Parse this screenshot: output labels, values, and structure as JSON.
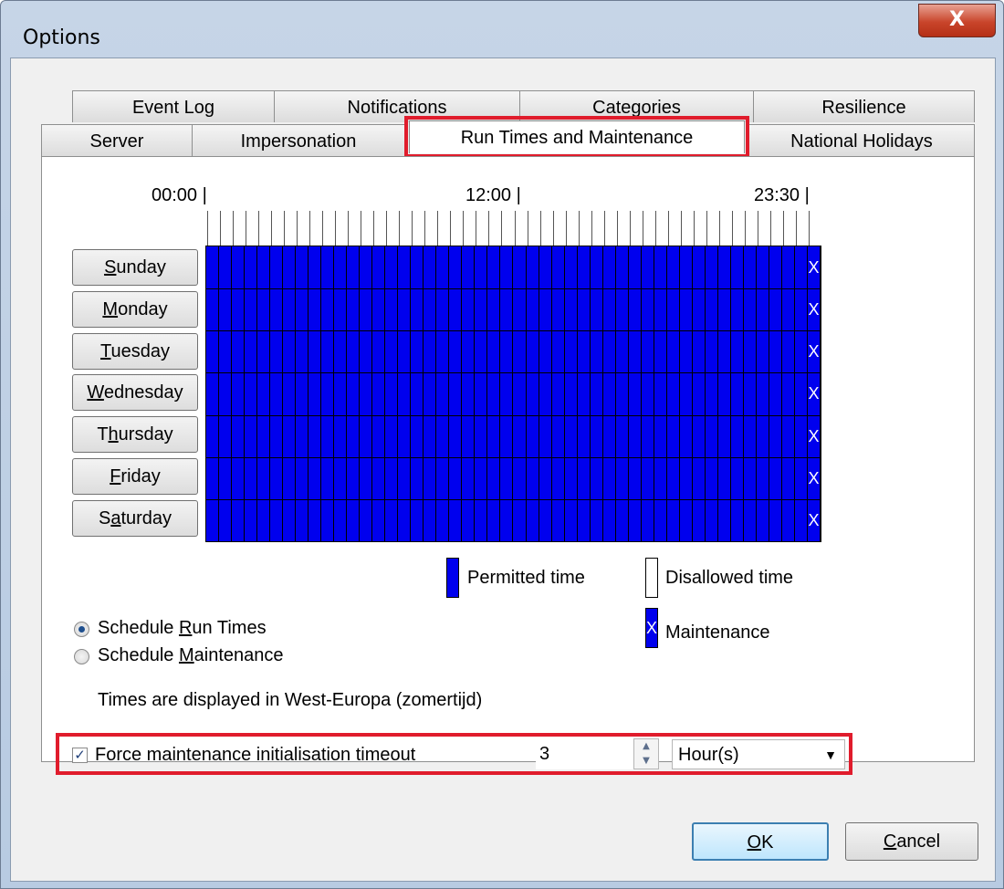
{
  "window": {
    "title": "Options",
    "close_glyph": "X"
  },
  "tabs": {
    "row1": [
      "Event Log",
      "Notifications",
      "Categories",
      "Resilience"
    ],
    "row2": [
      "Server",
      "Impersonation",
      "Run Times and Maintenance",
      "National Holidays"
    ],
    "active": "Run Times and Maintenance"
  },
  "timeline": {
    "start": "00:00",
    "middle": "12:00",
    "end": "23:30"
  },
  "days": [
    {
      "pre": "",
      "key": "S",
      "post": "unday"
    },
    {
      "pre": "",
      "key": "M",
      "post": "onday"
    },
    {
      "pre": "",
      "key": "T",
      "post": "uesday"
    },
    {
      "pre": "",
      "key": "W",
      "post": "ednesday"
    },
    {
      "pre": "T",
      "key": "h",
      "post": "ursday"
    },
    {
      "pre": "",
      "key": "F",
      "post": "riday"
    },
    {
      "pre": "S",
      "key": "a",
      "post": "turday"
    }
  ],
  "grid": {
    "slots_per_day": 48,
    "maintenance_slot": "23:30",
    "maintenance_mark": "X"
  },
  "legend": {
    "permitted": "Permitted time",
    "disallowed": "Disallowed time",
    "maintenance": "Maintenance",
    "maintenance_mark": "X",
    "permitted_color": "#0000ee",
    "disallowed_color": "#ffffff"
  },
  "schedule": {
    "run_times": {
      "pre": "Schedule ",
      "key": "R",
      "post": "un Times",
      "selected": true
    },
    "maintenance": {
      "pre": "Schedule ",
      "key": "M",
      "post": "aintenance",
      "selected": false
    }
  },
  "timezone_note": "Times are displayed in West-Europa (zomertijd)",
  "force_timeout": {
    "checked": true,
    "check_glyph": "✓",
    "label": "Force maintenance initialisation timeout",
    "value": "3",
    "unit": "Hour(s)"
  },
  "buttons": {
    "ok": {
      "key": "O",
      "post": "K"
    },
    "cancel": {
      "key": "C",
      "post": "ancel"
    }
  },
  "highlight_color": "#e01c2c"
}
